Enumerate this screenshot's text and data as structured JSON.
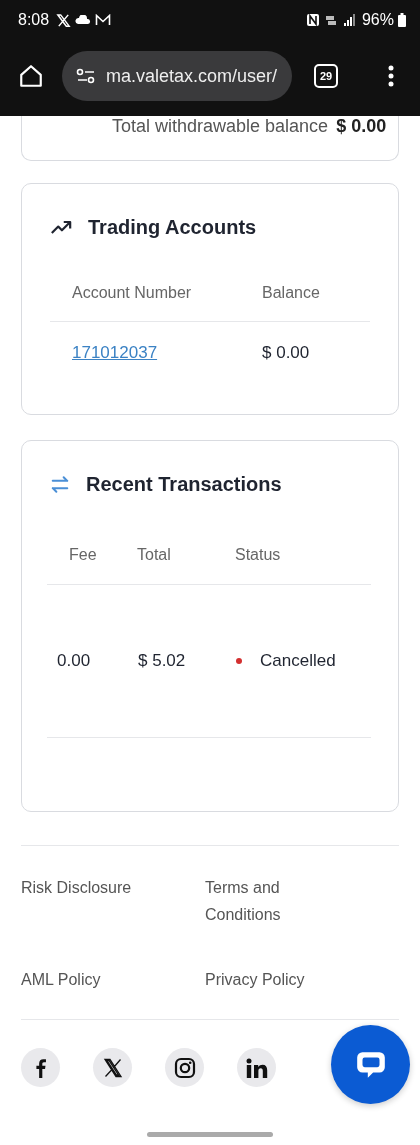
{
  "status_bar": {
    "time": "8:08",
    "battery": "96%"
  },
  "browser": {
    "url": "ma.valetax.com/user/",
    "tab_count": "29"
  },
  "balance_card": {
    "label": "Total withdrawable balance",
    "value": "$ 0.00"
  },
  "trading_accounts": {
    "title": "Trading Accounts",
    "columns": [
      "Account Number",
      "Balance"
    ],
    "rows": [
      {
        "account": "171012037",
        "balance": "$ 0.00"
      }
    ]
  },
  "recent_transactions": {
    "title": "Recent Transactions",
    "columns": [
      "Fee",
      "Total",
      "Status"
    ],
    "rows": [
      {
        "fee": "0.00",
        "total": "$ 5.02",
        "status": "Cancelled",
        "color": "#d32f2f"
      }
    ]
  },
  "footer": {
    "links": [
      "Risk Disclosure",
      "Terms and Conditions",
      "AML Policy",
      "Privacy Policy"
    ],
    "social": [
      {
        "kind": "facebook"
      },
      {
        "kind": "x"
      },
      {
        "kind": "instagram"
      },
      {
        "kind": "linkedin"
      }
    ]
  }
}
